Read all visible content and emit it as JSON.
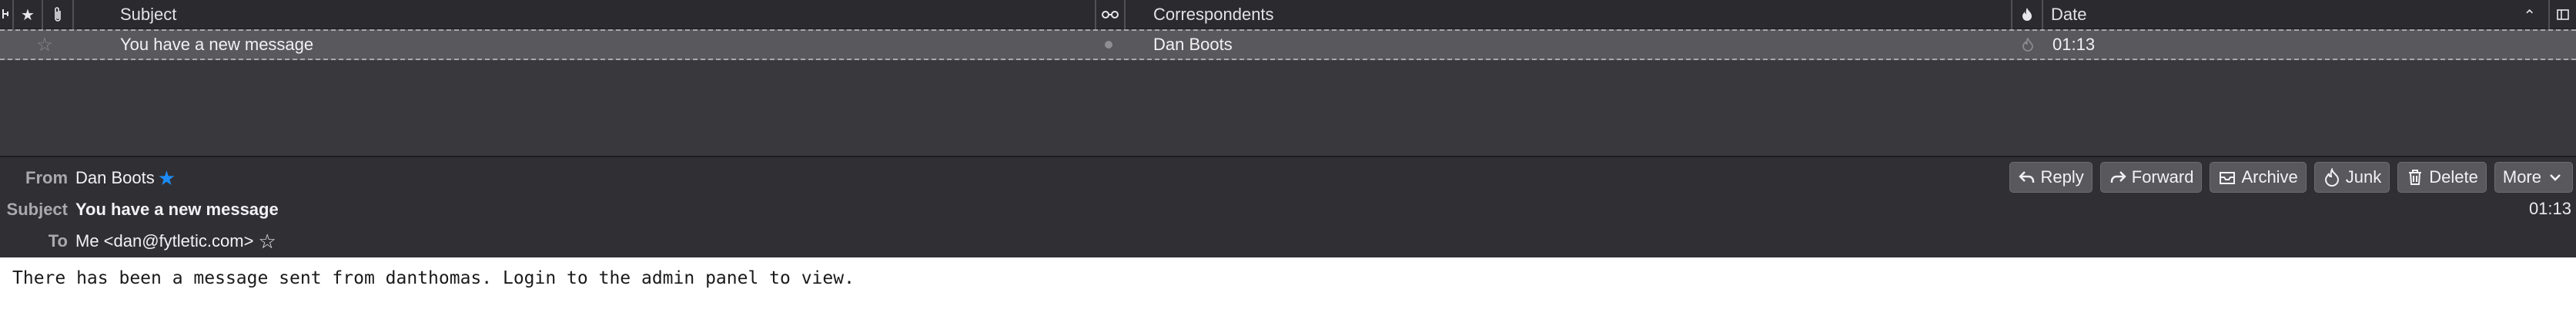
{
  "thread_list": {
    "columns": {
      "subject": "Subject",
      "correspondents": "Correspondents",
      "date": "Date"
    },
    "icons": {
      "thread": "thread-icon",
      "star": "star-icon",
      "attachment": "paperclip-icon",
      "read_status": "glasses-icon",
      "junk": "flame-icon",
      "sort": "chevron-up-icon",
      "column_picker": "column-picker-icon"
    },
    "rows": [
      {
        "subject": "You have a new message",
        "correspondent": "Dan Boots",
        "date": "01:13"
      }
    ]
  },
  "message": {
    "from_label": "From",
    "from_name": "Dan Boots",
    "subject_label": "Subject",
    "subject": "You have a new message",
    "to_label": "To",
    "to_value": "Me <dan@fytletic.com>",
    "date": "01:13",
    "actions": {
      "reply": "Reply",
      "forward": "Forward",
      "archive": "Archive",
      "junk": "Junk",
      "delete": "Delete",
      "more": "More"
    },
    "body": "There has been a message sent from danthomas. Login to the admin panel to view."
  },
  "colors": {
    "contact_star": "#1d8cf8",
    "selected_row": "#59585d",
    "header_bg": "#303034",
    "list_bg": "#39383d"
  }
}
